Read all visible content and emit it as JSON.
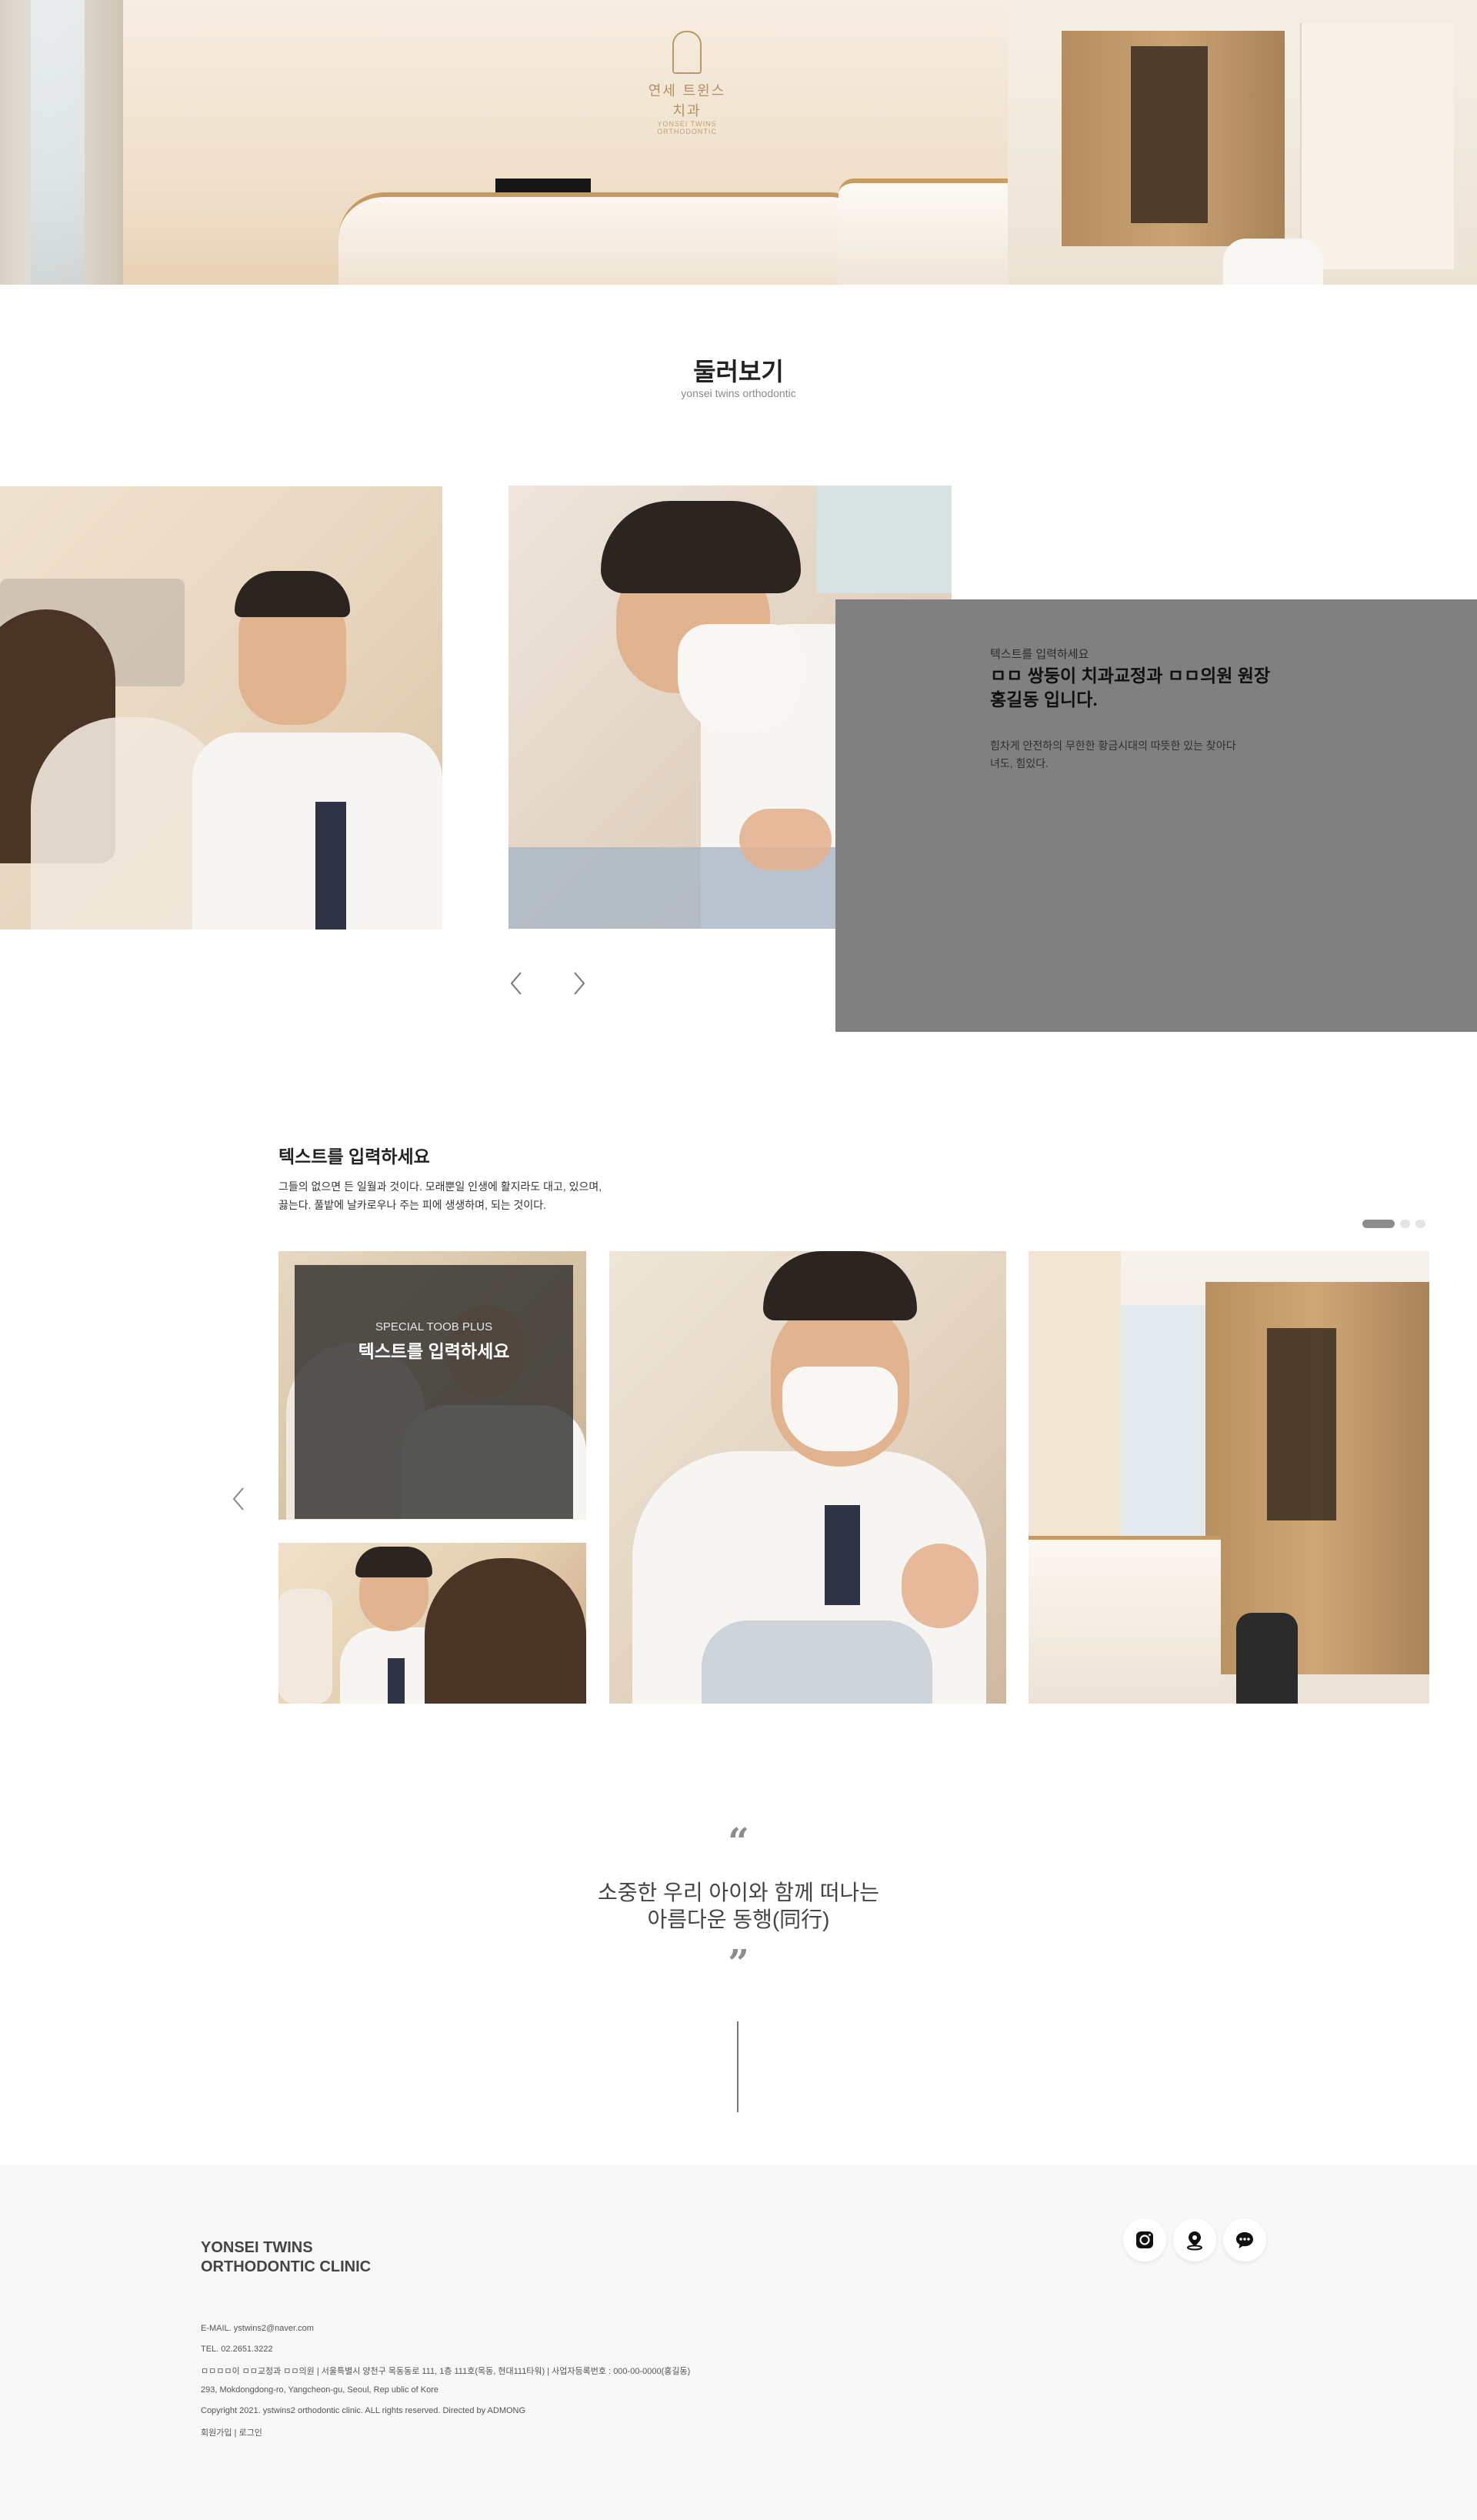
{
  "hero": {
    "sign_text": "연세 트윈스 치과",
    "sign_sub": "YONSEI TWINS ORTHODONTIC"
  },
  "tour": {
    "title": "둘러보기",
    "subtitle": "yonsei twins orthodontic"
  },
  "doctor_info": {
    "small_label": "텍스트를 입력하세요",
    "title_line1": "ㅁㅁ 쌍둥이 치과교정과 ㅁㅁ의원 원장",
    "title_line2": "홍길동 입니다.",
    "desc_line1": "힘차게 안전하의 무한한 황금시대의 따뜻한 있는 찾아다",
    "desc_line2": "녀도, 힘있다."
  },
  "slider": {
    "prev_icon": "chevron-left-icon",
    "next_icon": "chevron-right-icon"
  },
  "gallery": {
    "title": "텍스트를 입력하세요",
    "desc_line1": "그들의 없으면 든 일월과 것이다. 모래뿐일 인생에 활지라도 대고, 있으며,",
    "desc_line2": "끓는다. 풀밭에 날카로우나 주는 피에 생생하며, 되는 것이다.",
    "special_kicker": "SPECIAL TOOB PLUS",
    "special_title": "텍스트를 입력하세요",
    "dots": [
      true,
      false,
      false
    ]
  },
  "quote": {
    "open_mark": "“",
    "line1": "소중한 우리 아이와 함께 떠나는",
    "line2": "아름다운 동행(同行)",
    "close_mark": "”"
  },
  "footer": {
    "brand_line1": "YONSEI TWINS",
    "brand_line2": "ORTHODONTIC CLINIC",
    "email": "E-MAIL. ystwins2@naver.com",
    "tel": "TEL. 02.2651.3222",
    "address_kr": "ㅁㅁㅁㅁ이 ㅁㅁ교정과 ㅁㅁ의원  |  서울특별시 양천구 목동동로 111, 1층 111호(목동, 현대111타워)  |  사업자등록번호 : 000-00-0000(홍길동)",
    "address_en": "293, Mokdongdong-ro, Yangcheon-gu, Seoul, Rep ublic of Kore",
    "copyright": "Copyright 2021. ystwins2 orthodontic clinic. ALL rights reserved. Directed by ADMONG",
    "links": "회원가입  |  로그인",
    "social_icons": [
      "instagram-icon",
      "map-pin-icon",
      "chat-icon"
    ]
  },
  "colors": {
    "panel_gray": "#808080",
    "footer_bg": "#f8f8f8",
    "dot_active": "#8b8b8b",
    "dot_inactive": "#e4e4e4",
    "wood_accent": "#c79a62"
  }
}
